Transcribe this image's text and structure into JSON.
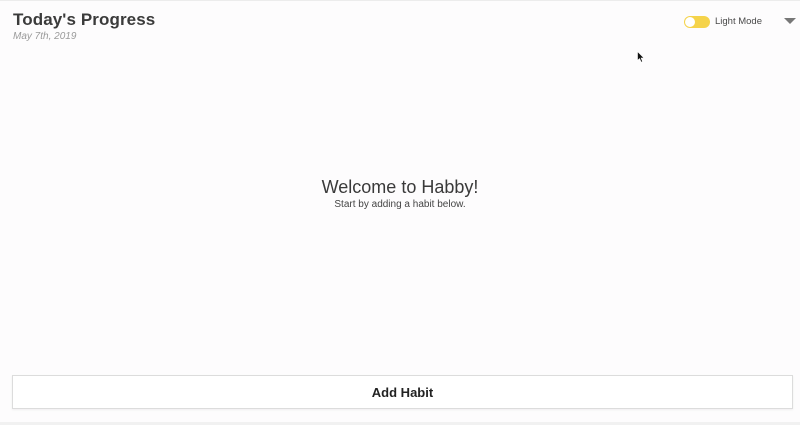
{
  "header": {
    "title": "Today's Progress",
    "date": "May 7th, 2019"
  },
  "theme": {
    "label": "Light Mode",
    "toggle_color": "#f5d34a",
    "enabled": false
  },
  "welcome": {
    "title": "Welcome to Habby!",
    "subtitle": "Start by adding a habit below."
  },
  "actions": {
    "add_habit_label": "Add Habit"
  },
  "icons": {
    "menu": "chevron-down-icon",
    "cursor": "mouse-pointer-icon"
  }
}
